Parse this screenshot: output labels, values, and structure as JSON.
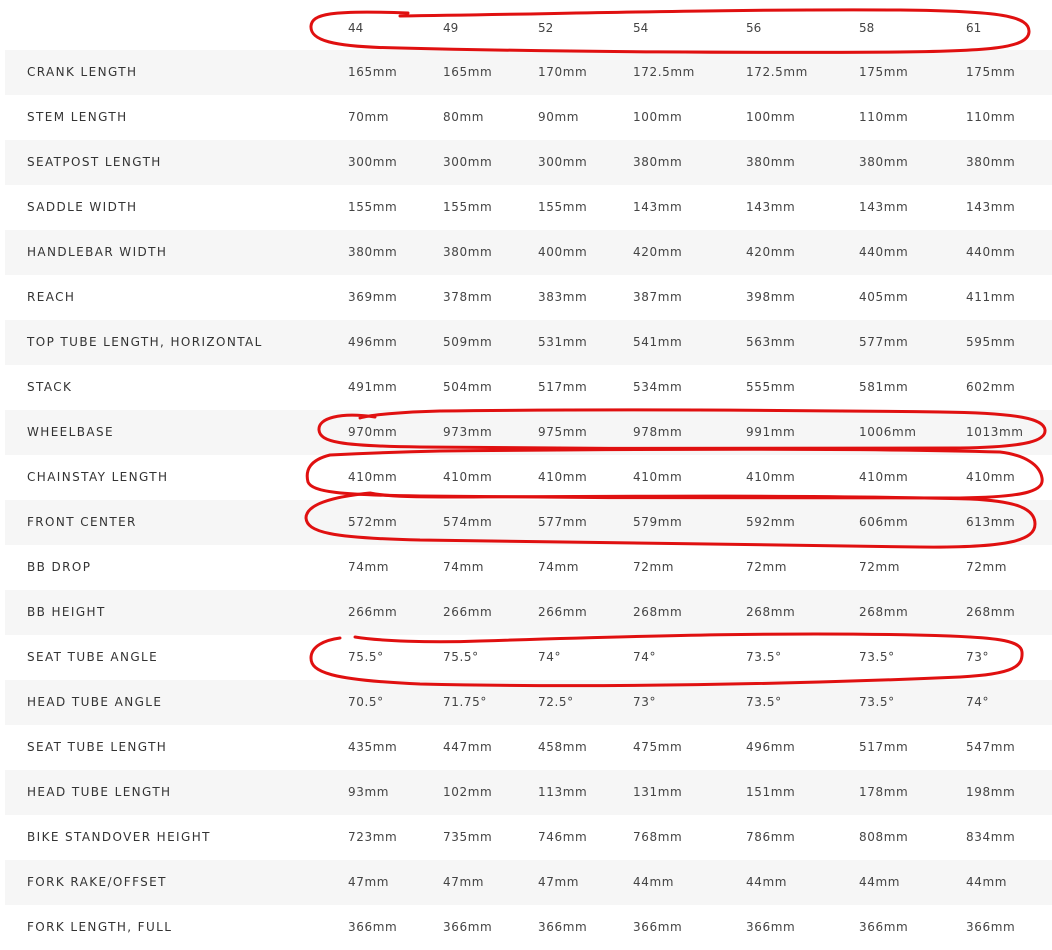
{
  "sizes": [
    "44",
    "49",
    "52",
    "54",
    "56",
    "58",
    "61"
  ],
  "rows": [
    {
      "label": "CRANK LENGTH",
      "values": [
        "165mm",
        "165mm",
        "170mm",
        "172.5mm",
        "172.5mm",
        "175mm",
        "175mm"
      ]
    },
    {
      "label": "STEM LENGTH",
      "values": [
        "70mm",
        "80mm",
        "90mm",
        "100mm",
        "100mm",
        "110mm",
        "110mm"
      ]
    },
    {
      "label": "SEATPOST LENGTH",
      "values": [
        "300mm",
        "300mm",
        "300mm",
        "380mm",
        "380mm",
        "380mm",
        "380mm"
      ]
    },
    {
      "label": "SADDLE WIDTH",
      "values": [
        "155mm",
        "155mm",
        "155mm",
        "143mm",
        "143mm",
        "143mm",
        "143mm"
      ]
    },
    {
      "label": "HANDLEBAR WIDTH",
      "values": [
        "380mm",
        "380mm",
        "400mm",
        "420mm",
        "420mm",
        "440mm",
        "440mm"
      ]
    },
    {
      "label": "REACH",
      "values": [
        "369mm",
        "378mm",
        "383mm",
        "387mm",
        "398mm",
        "405mm",
        "411mm"
      ]
    },
    {
      "label": "TOP TUBE LENGTH, HORIZONTAL",
      "values": [
        "496mm",
        "509mm",
        "531mm",
        "541mm",
        "563mm",
        "577mm",
        "595mm"
      ]
    },
    {
      "label": "STACK",
      "values": [
        "491mm",
        "504mm",
        "517mm",
        "534mm",
        "555mm",
        "581mm",
        "602mm"
      ]
    },
    {
      "label": "WHEELBASE",
      "values": [
        "970mm",
        "973mm",
        "975mm",
        "978mm",
        "991mm",
        "1006mm",
        "1013mm"
      ]
    },
    {
      "label": "CHAINSTAY LENGTH",
      "values": [
        "410mm",
        "410mm",
        "410mm",
        "410mm",
        "410mm",
        "410mm",
        "410mm"
      ]
    },
    {
      "label": "FRONT CENTER",
      "values": [
        "572mm",
        "574mm",
        "577mm",
        "579mm",
        "592mm",
        "606mm",
        "613mm"
      ]
    },
    {
      "label": "BB DROP",
      "values": [
        "74mm",
        "74mm",
        "74mm",
        "72mm",
        "72mm",
        "72mm",
        "72mm"
      ]
    },
    {
      "label": "BB HEIGHT",
      "values": [
        "266mm",
        "266mm",
        "266mm",
        "268mm",
        "268mm",
        "268mm",
        "268mm"
      ]
    },
    {
      "label": "SEAT TUBE ANGLE",
      "values": [
        "75.5°",
        "75.5°",
        "74°",
        "74°",
        "73.5°",
        "73.5°",
        "73°"
      ]
    },
    {
      "label": "HEAD TUBE ANGLE",
      "values": [
        "70.5°",
        "71.75°",
        "72.5°",
        "73°",
        "73.5°",
        "73.5°",
        "74°"
      ]
    },
    {
      "label": "SEAT TUBE LENGTH",
      "values": [
        "435mm",
        "447mm",
        "458mm",
        "475mm",
        "496mm",
        "517mm",
        "547mm"
      ]
    },
    {
      "label": "HEAD TUBE LENGTH",
      "values": [
        "93mm",
        "102mm",
        "113mm",
        "131mm",
        "151mm",
        "178mm",
        "198mm"
      ]
    },
    {
      "label": "BIKE STANDOVER HEIGHT",
      "values": [
        "723mm",
        "735mm",
        "746mm",
        "768mm",
        "786mm",
        "808mm",
        "834mm"
      ]
    },
    {
      "label": "FORK RAKE/OFFSET",
      "values": [
        "47mm",
        "47mm",
        "47mm",
        "44mm",
        "44mm",
        "44mm",
        "44mm"
      ]
    },
    {
      "label": "FORK LENGTH, FULL",
      "values": [
        "366mm",
        "366mm",
        "366mm",
        "366mm",
        "366mm",
        "366mm",
        "366mm"
      ]
    }
  ],
  "colors": {
    "stripe": "#f6f6f6",
    "text": "#333333",
    "annotation": "#e01010"
  }
}
